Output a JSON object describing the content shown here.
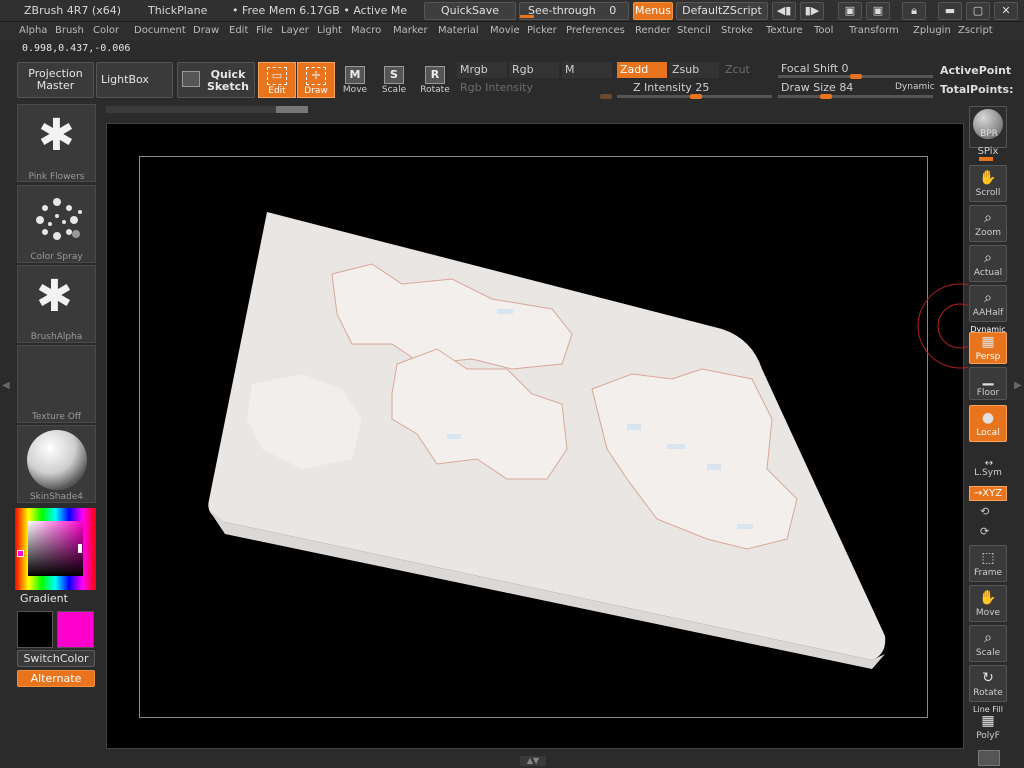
{
  "titlebar": {
    "app": "ZBrush 4R7 (x64)",
    "document": "ThickPlane",
    "mem": "• Free Mem 6.17GB • Active Me",
    "quicksave": "QuickSave",
    "see_through": "See-through",
    "see_through_value": "0",
    "menus": "Menus",
    "script": "DefaultZScript"
  },
  "menubar": [
    "Alpha",
    "Brush",
    "Color",
    "Document",
    "Draw",
    "Edit",
    "File",
    "Layer",
    "Light",
    "Macro",
    "Marker",
    "Material",
    "Movie",
    "Picker",
    "Preferences",
    "Render",
    "Stencil",
    "Stroke",
    "Texture",
    "Tool",
    "Transform",
    "Zplugin",
    "Zscript"
  ],
  "coords": "0.998,0.437,-0.006",
  "shelf": {
    "projection_master": "Projection Master",
    "lightbox": "LightBox",
    "quick_sketch": "Quick Sketch",
    "tools": [
      {
        "label": "Edit",
        "glyph": "▭",
        "active": true
      },
      {
        "label": "Draw",
        "glyph": "✛",
        "active": true
      },
      {
        "label": "Move",
        "glyph": "M",
        "active": false
      },
      {
        "label": "Scale",
        "glyph": "S",
        "active": false
      },
      {
        "label": "Rotate",
        "glyph": "R",
        "active": false
      }
    ],
    "mrgb": "Mrgb",
    "rgb": "Rgb",
    "m": "M",
    "rgb_intensity": "Rgb Intensity",
    "zadd": "Zadd",
    "zsub": "Zsub",
    "zcut": "Zcut",
    "z_intensity_label": "Z Intensity",
    "z_intensity_value": "25",
    "focal_shift_label": "Focal Shift",
    "focal_shift_value": "0",
    "draw_size_label": "Draw Size",
    "draw_size_value": "84",
    "dynamic": "Dynamic",
    "active_points": "ActivePoint",
    "total_points": "TotalPoints:"
  },
  "left_panel": {
    "brush_label": "Pink Flowers",
    "stroke_label": "Color Spray",
    "alpha_label": "BrushAlpha",
    "texture_label": "Texture Off",
    "material_label": "SkinShade4",
    "gradient_label": "Gradient",
    "switch_color": "SwitchColor",
    "alternate": "Alternate",
    "colors": {
      "main": "#000000",
      "secondary": "#ff00cc"
    }
  },
  "right_shelf": {
    "bpr": "BPR",
    "spix": "SPix",
    "buttons": [
      {
        "name": "scroll",
        "label": "Scroll",
        "glyph": "✋",
        "orange": false
      },
      {
        "name": "zoom",
        "label": "Zoom",
        "glyph": "⌕",
        "orange": false
      },
      {
        "name": "actual",
        "label": "Actual",
        "glyph": "⌕",
        "orange": false
      },
      {
        "name": "aahalf",
        "label": "AAHalf",
        "glyph": "⌕",
        "orange": false
      },
      {
        "name": "persp",
        "label": "Persp",
        "glyph": "▦",
        "orange": true
      },
      {
        "name": "floor",
        "label": "Floor",
        "glyph": "▁",
        "orange": false
      },
      {
        "name": "local",
        "label": "Local",
        "glyph": "●",
        "orange": true
      },
      {
        "name": "frame",
        "label": "Frame",
        "glyph": "⬚",
        "orange": false
      },
      {
        "name": "move",
        "label": "Move",
        "glyph": "✋",
        "orange": false
      },
      {
        "name": "scale",
        "label": "Scale",
        "glyph": "⌕",
        "orange": false
      },
      {
        "name": "rotate",
        "label": "Rotate",
        "glyph": "↻",
        "orange": false
      },
      {
        "name": "polyf",
        "label": "PolyF",
        "glyph": "▦",
        "orange": false
      }
    ],
    "dynamic_tag": "Dynamic",
    "lsym": "L.Sym",
    "xyz": "→XYZ",
    "line_fill": "Line Fill"
  }
}
